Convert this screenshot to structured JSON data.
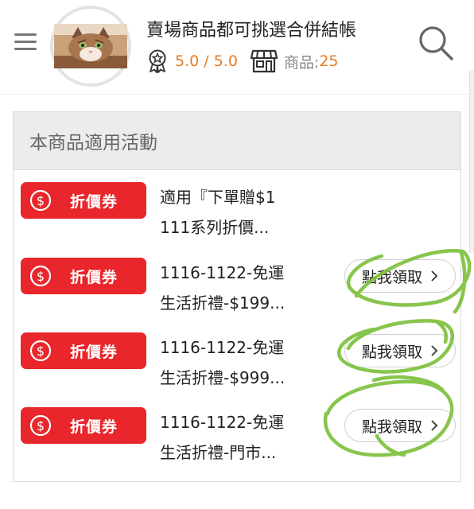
{
  "header": {
    "store_name": "賣場商品都可挑選合併結帳",
    "rating": "5.0 / 5.0",
    "products_label": "商品:",
    "products_count": "25",
    "icons": [
      "menu-icon",
      "rosette-badge-icon",
      "storefront-icon",
      "search-icon"
    ]
  },
  "panel": {
    "title": "本商品適用活動",
    "rows": [
      {
        "badge": "折價券",
        "line1": "適用『下單贈$1",
        "line2": "111系列折價...",
        "claim": ""
      },
      {
        "badge": "折價券",
        "line1": "1116-1122-免運",
        "line2": "生活折禮-$199...",
        "claim": "點我領取"
      },
      {
        "badge": "折價券",
        "line1": "1116-1122-免運",
        "line2": "生活折禮-$999...",
        "claim": "點我領取"
      },
      {
        "badge": "折價券",
        "line1": "1116-1122-免運",
        "line2": "生活折禮-門市...",
        "claim": "點我領取"
      }
    ]
  },
  "colors": {
    "badge_red": "#e8262b",
    "accent_orange": "#e67e22",
    "annotation_green": "#7bbf3a"
  }
}
